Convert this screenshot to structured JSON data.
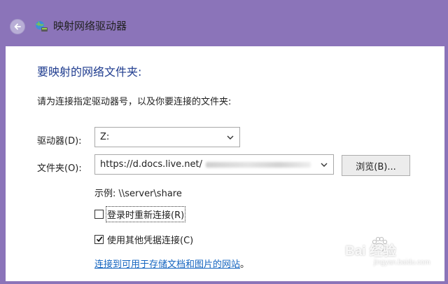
{
  "window": {
    "title": "映射网络驱动器",
    "accent_color": "#8b74b9",
    "back_icon": "back-arrow-icon",
    "app_icon": "network-drive-icon"
  },
  "main": {
    "heading": "要映射的网络文件夹:",
    "instruction": "请为连接指定驱动器号，以及你要连接的文件夹:",
    "drive": {
      "label": "驱动器(D):",
      "value": "Z:"
    },
    "folder": {
      "label": "文件夹(O):",
      "value": "https://d.docs.live.net/"
    },
    "browse_button": "浏览(B)...",
    "example": "示例: \\\\server\\share",
    "reconnect": {
      "label": "登录时重新连接(R)",
      "checked": false
    },
    "credentials": {
      "label": "使用其他凭据连接(C)",
      "checked": true
    },
    "link": {
      "text": "连接到可用于存储文档和图片的网站",
      "suffix": "。"
    }
  },
  "watermark": {
    "brand": "Bai 经验",
    "url": "jingyan.baidu.com"
  }
}
